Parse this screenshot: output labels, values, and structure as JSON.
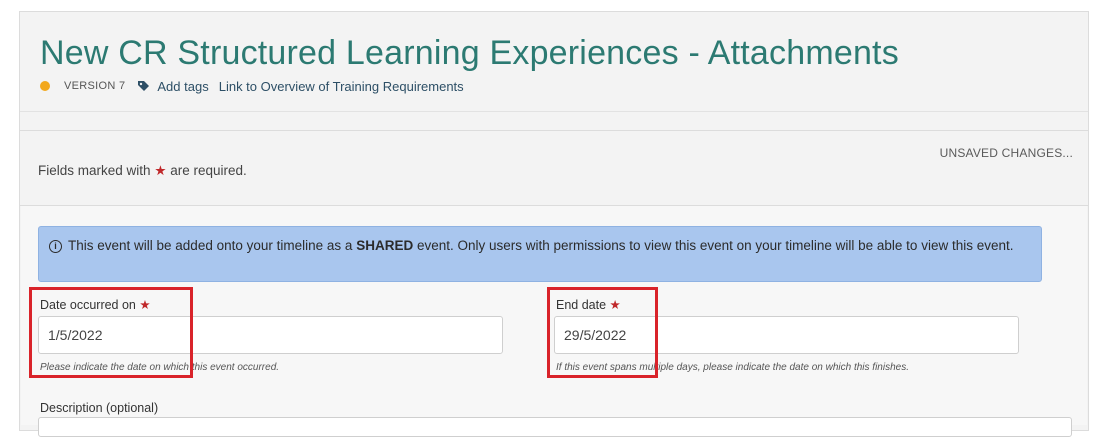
{
  "header": {
    "title": "New CR Structured Learning Experiences - Attachments",
    "status_dot_color": "#f2a81d",
    "version": "VERSION 7",
    "tag_icon": "tag-icon",
    "add_tags": "Add tags",
    "overview_link": "Link to Overview of Training Requirements"
  },
  "form": {
    "unsaved": "UNSAVED CHANGES...",
    "required_prefix": "Fields marked with",
    "required_star": "★",
    "required_suffix": "are required.",
    "info": {
      "icon": "info-icon",
      "text_before": "This event will be added onto your timeline as a",
      "text_bold": "SHARED",
      "text_after": "event. Only users with permissions to view this event on your timeline will be able to view this event."
    },
    "date_occurred": {
      "label": "Date occurred on",
      "star": "★",
      "value": "1/5/2022",
      "hint": "Please indicate the date on which this event occurred."
    },
    "end_date": {
      "label": "End date",
      "star": "★",
      "value": "29/5/2022",
      "hint": "If this event spans multiple days, please indicate the date on which this finishes."
    },
    "description": {
      "label": "Description (optional)"
    }
  },
  "colors": {
    "title": "#2c7a72",
    "link": "#2d4f66",
    "info_bg": "#a9c6ee",
    "required_star": "#c0282a",
    "annotation_box": "#d9232a"
  }
}
